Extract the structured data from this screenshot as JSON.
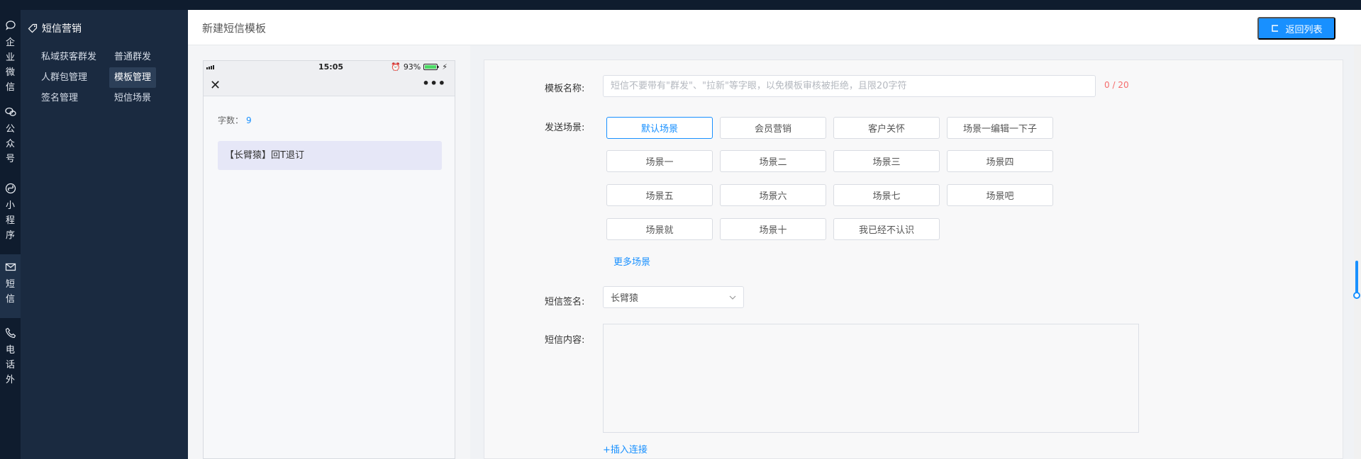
{
  "rail": {
    "items": [
      {
        "label": "企业微信",
        "icon": "chat-bubble-icon"
      },
      {
        "label": "公众号",
        "icon": "wechat-icon"
      },
      {
        "label": "小程序",
        "icon": "mini-program-icon"
      },
      {
        "label": "短信",
        "icon": "mail-icon"
      },
      {
        "label": "电话外",
        "icon": "phone-icon"
      }
    ]
  },
  "submenu": {
    "title": "短信营销",
    "title_icon": "tag-icon",
    "links": [
      "私域获客群发",
      "普通群发",
      "人群包管理",
      "模板管理",
      "签名管理",
      "短信场景"
    ],
    "active": "模板管理"
  },
  "header": {
    "title": "新建短信模板",
    "back_label": "返回列表"
  },
  "phone": {
    "time": "15:05",
    "battery": "93%",
    "close_glyph": "✕",
    "more_glyph": "•••",
    "char_count_label": "字数：",
    "char_count": "9",
    "message": "【长臂猿】回T退订"
  },
  "form": {
    "name_label": "模板名称:",
    "name_placeholder": "短信不要带有\"群发\"、\"拉新\"等字眼，以免模板审核被拒绝，且限20字符",
    "name_counter": "0 / 20",
    "scene_label": "发送场景:",
    "scenes": [
      "默认场景",
      "会员营销",
      "客户关怀",
      "场景一编辑一下子",
      "场景一",
      "场景二",
      "场景三",
      "场景四",
      "场景五",
      "场景六",
      "场景七",
      "场景吧",
      "场景就",
      "场景十",
      "我已经不认识"
    ],
    "active_scene": "默认场景",
    "more_scenes": "更多场景",
    "sign_label": "短信签名:",
    "sign_value": "长臂猿",
    "content_label": "短信内容:",
    "insert_link": "+插入连接"
  },
  "colors": {
    "primary": "#1890ff",
    "sidebar_dark": "#0f1c2e",
    "submenu_bg": "#1a2a40",
    "counter_red": "#f56c6c"
  }
}
